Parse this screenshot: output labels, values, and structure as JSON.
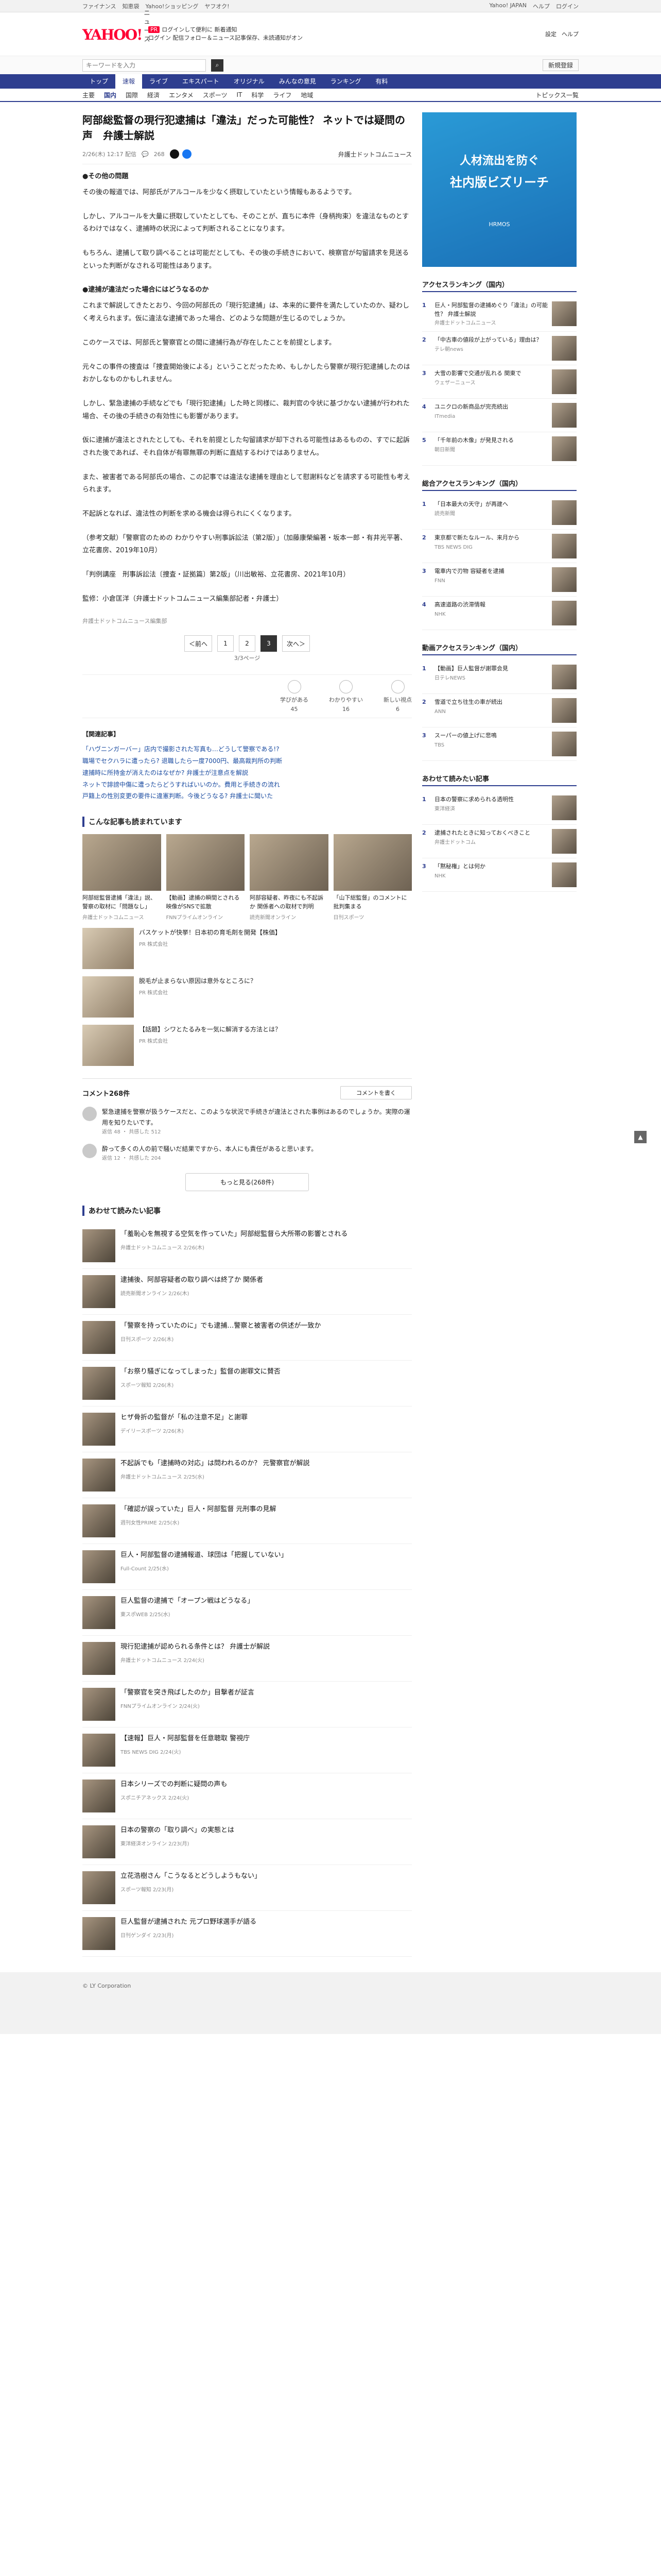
{
  "topbar": {
    "links": [
      "ファイナンス",
      "知恵袋",
      "Yahoo!ショッピング",
      "ヤフオク!"
    ],
    "right": [
      "Yahoo! JAPAN",
      "ヘルプ",
      "ログイン"
    ]
  },
  "header": {
    "logo": "YAHOO!",
    "logo_sub": "ニュース",
    "promo_badge": "PR",
    "promo_line1": "ログインして便利に 新着通知",
    "promo_line2": "ログイン 配信フォロー＆ニュース記事保存、未読通知がオン",
    "right": [
      "設定",
      "ヘルプ"
    ]
  },
  "search": {
    "placeholder": "キーワードを入力",
    "login": "新規登録"
  },
  "nav": [
    "トップ",
    "速報",
    "ライブ",
    "エキスパート",
    "オリジナル",
    "みんなの意見",
    "ランキング",
    "有料"
  ],
  "nav_active": 1,
  "subnav": [
    "主要",
    "国内",
    "国際",
    "経済",
    "エンタメ",
    "スポーツ",
    "IT",
    "科学",
    "ライフ",
    "地域"
  ],
  "subnav_active": "国内",
  "subnav_topics": "トピックス一覧",
  "article": {
    "title": "阿部総監督の現行犯逮捕は「違法」だった可能性？ ネットでは疑問の声　弁護士解説",
    "date": "2/26(木) 12:17 配信",
    "comments": "268",
    "source": "弁護士ドットコムニュース",
    "sections": [
      {
        "heading": "●その他の問題",
        "paras": [
          "その後の報道では、阿部氏がアルコールを少なく摂取していたという情報もあるようです。",
          "しかし、アルコールを大量に摂取していたとしても、そのことが、直ちに本件（身柄拘束）を違法なものとするわけではなく、逮捕時の状況によって判断されることになります。",
          "もちろん、逮捕して取り調べることは可能だとしても、その後の手続きにおいて、検察官が勾留請求を見送るといった判断がなされる可能性はあります。"
        ]
      },
      {
        "heading": "●逮捕が違法だった場合にはどうなるのか",
        "paras": [
          "これまで解説してきたとおり、今回の阿部氏の「現行犯逮捕」は、本来的に要件を満たしていたのか、疑わしく考えられます。仮に違法な逮捕であった場合、どのような問題が生じるのでしょうか。",
          "このケースでは、阿部氏と警察官との間に逮捕行為が存在したことを前提とします。",
          "元々この事件の捜査は「捜査開始後による」ということだったため、もしかしたら警察が現行犯逮捕したのはおかしなものかもしれません。",
          "しかし、緊急逮捕の手続などでも「現行犯逮捕」した時と同様に、裁判官の令状に基づかない逮捕が行われた場合、その後の手続きの有効性にも影響があります。",
          "仮に逮捕が違法とされたとしても、それを前提とした勾留請求が却下される可能性はあるものの、すでに起訴された後であれば、それ自体が有罪無罪の判断に直結するわけではありません。",
          "また、被害者である阿部氏の場合、この記事では違法な逮捕を理由として慰謝料などを請求する可能性も考えられます。",
          "不起訴となれば、違法性の判断を求める機会は得られにくくなります。"
        ]
      }
    ],
    "refs": [
      "（参考文献）「警察官のための わかりやすい刑事訴訟法（第2版）」（加藤康榮編著・坂本一郎・有井光平著、立花書房、2019年10月）",
      "「判例講座　刑事訴訟法〔捜査・証拠篇〕第2版」（川出敏裕、立花書房、2021年10月）"
    ],
    "supervisor": "監修：小倉匡洋（弁護士ドットコムニュース編集部記者・弁護士）",
    "credit": "弁護士ドットコムニュース編集部",
    "pager": [
      "＜前へ",
      "1",
      "2",
      "3",
      "次へ＞"
    ],
    "pager_current": "3",
    "pageinfo": "3/3ページ"
  },
  "reactions": [
    {
      "label": "学びがある",
      "count": "45"
    },
    {
      "label": "わかりやすい",
      "count": "16"
    },
    {
      "label": "新しい視点",
      "count": "6"
    }
  ],
  "related": {
    "title": "【関連記事】",
    "links": [
      "「ハヴニンガーバー」店内で撮影された写真も…どうして警察である!?",
      "職場でセクハラに遭ったら? 退職したら一度7000円、最高裁判所の判断",
      "逮捕時に所持金が消えたのはなぜか? 弁護士が注意点を解説",
      "ネットで誹謗中傷に遭ったらどうすればいいのか。費用と手続きの流れ",
      "戸籍上の性別変更の要件に違憲判断。今後どうなる? 弁護士に聞いた"
    ]
  },
  "recommend": {
    "title": "こんな記事も読まれています",
    "cards": [
      {
        "t": "阿部総監督逮捕「違法」説、警察の取材に「問題なし」",
        "s": "弁護士ドットコムニュース"
      },
      {
        "t": "【動画】逮捕の瞬間とされる映像がSNSで拡散",
        "s": "FNNプライムオンライン"
      },
      {
        "t": "阿部容疑者、昨夜にも不起訴か 関係者への取材で判明",
        "s": "読売新聞オンライン"
      },
      {
        "t": "「山下総監督」のコメントに批判集まる",
        "s": "日刊スポーツ"
      }
    ],
    "ads": [
      {
        "t": "バスケットが快挙！日本初の育毛剤を開発【株価】",
        "s": "PR 株式会社"
      },
      {
        "t": "脱毛が止まらない原因は意外なところに？",
        "s": "PR 株式会社"
      },
      {
        "t": "【話題】シワとたるみを一気に解消する方法とは？",
        "s": "PR 株式会社"
      }
    ]
  },
  "comments": {
    "title": "コメント268件",
    "button": "コメントを書く",
    "items": [
      {
        "t": "緊急逮捕を警察が扱うケースだと、このような状況で手続きが違法とされた事例はあるのでしょうか。実際の運用を知りたいです。",
        "s": "返信 48 ・ 共感した 512"
      },
      {
        "t": "酔って多くの人の前で騒いだ結果ですから、本人にも責任があると思います。",
        "s": "返信 12 ・ 共感した 204"
      }
    ],
    "more": "もっと見る(268件)"
  },
  "recs": {
    "title": "あわせて読みたい記事",
    "items": [
      {
        "t": "「羞恥心を無視する空気を作っていた」阿部総監督ら大所帯の影響とされる",
        "s": "弁護士ドットコムニュース 2/26(木)"
      },
      {
        "t": "逮捕後、阿部容疑者の取り調べは終了か 関係者",
        "s": "読売新聞オンライン 2/26(木)"
      },
      {
        "t": "「警察を持っていたのに」でも逮捕…警察と被害者の供述が一致か",
        "s": "日刊スポーツ 2/26(木)"
      },
      {
        "t": "「お祭り騒ぎになってしまった」監督の謝罪文に賛否",
        "s": "スポーツ報知 2/26(木)"
      },
      {
        "t": "ヒザ骨折の監督が「私の注意不足」と謝罪",
        "s": "デイリースポーツ 2/26(木)"
      },
      {
        "t": "不起訴でも「逮捕時の対応」は問われるのか？ 元警察官が解説",
        "s": "弁護士ドットコムニュース 2/25(水)"
      },
      {
        "t": "「確認が誤っていた」巨人・阿部監督 元刑事の見解",
        "s": "週刊女性PRIME 2/25(水)"
      },
      {
        "t": "巨人・阿部監督の逮捕報道、球団は「把握していない」",
        "s": "Full-Count 2/25(水)"
      },
      {
        "t": "巨人監督の逮捕で「オープン戦はどうなる」",
        "s": "東スポWEB 2/25(水)"
      },
      {
        "t": "現行犯逮捕が認められる条件とは？ 弁護士が解説",
        "s": "弁護士ドットコムニュース 2/24(火)"
      },
      {
        "t": "「警察官を突き飛ばしたのか」目撃者が証言",
        "s": "FNNプライムオンライン 2/24(火)"
      },
      {
        "t": "【速報】巨人・阿部監督を任意聴取 警視庁",
        "s": "TBS NEWS DIG 2/24(火)"
      },
      {
        "t": "日本シリーズでの判断に疑問の声も",
        "s": "スポニチアネックス 2/24(火)"
      },
      {
        "t": "日本の警察の「取り調べ」の実態とは",
        "s": "東洋経済オンライン 2/23(月)"
      },
      {
        "t": "立花浩樹さん「こうなるとどうしようもない」",
        "s": "スポーツ報知 2/23(月)"
      },
      {
        "t": "巨人監督が逮捕された 元プロ野球選手が語る",
        "s": "日刊ゲンダイ 2/23(月)"
      }
    ]
  },
  "side": {
    "ad_line1": "人材流出を防ぐ",
    "ad_line2": "社内版ビズリーチ",
    "ad_foot": "HRMOS",
    "ranking_title": "アクセスランキング（国内）",
    "ranking": [
      {
        "t": "巨人・阿部監督の逮捕めぐり「違法」の可能性？ 弁護士解説",
        "s": "弁護士ドットコムニュース"
      },
      {
        "t": "「中古車の値段が上がっている」理由は？",
        "s": "テレ朝news"
      },
      {
        "t": "大雪の影響で交通が乱れる 関東で",
        "s": "ウェザーニュース"
      },
      {
        "t": "ユニクロの新商品が完売続出",
        "s": "ITmedia"
      },
      {
        "t": "「千年前の木像」が発見される",
        "s": "朝日新聞"
      }
    ],
    "ranking2_title": "総合アクセスランキング（国内）",
    "ranking2": [
      {
        "t": "「日本最大の天守」が再建へ",
        "s": "読売新聞"
      },
      {
        "t": "東京都で新たなルール、来月から",
        "s": "TBS NEWS DIG"
      },
      {
        "t": "電車内で刃物 容疑者を逮捕",
        "s": "FNN"
      },
      {
        "t": "高速道路の渋滞情報",
        "s": "NHK"
      }
    ],
    "ranking3_title": "動画アクセスランキング（国内）",
    "ranking3": [
      {
        "t": "【動画】巨人監督が謝罪会見",
        "s": "日テレNEWS"
      },
      {
        "t": "雪道で立ち往生の車が続出",
        "s": "ANN"
      },
      {
        "t": "スーパーの値上げに悲鳴",
        "s": "TBS"
      }
    ],
    "ranking4_title": "あわせて読みたい記事",
    "ranking4": [
      {
        "t": "日本の警察に求められる透明性",
        "s": "東洋経済"
      },
      {
        "t": "逮捕されたときに知っておくべきこと",
        "s": "弁護士ドットコム"
      },
      {
        "t": "「黙秘権」とは何か",
        "s": "NHK"
      }
    ]
  },
  "footer": "© LY Corporation"
}
